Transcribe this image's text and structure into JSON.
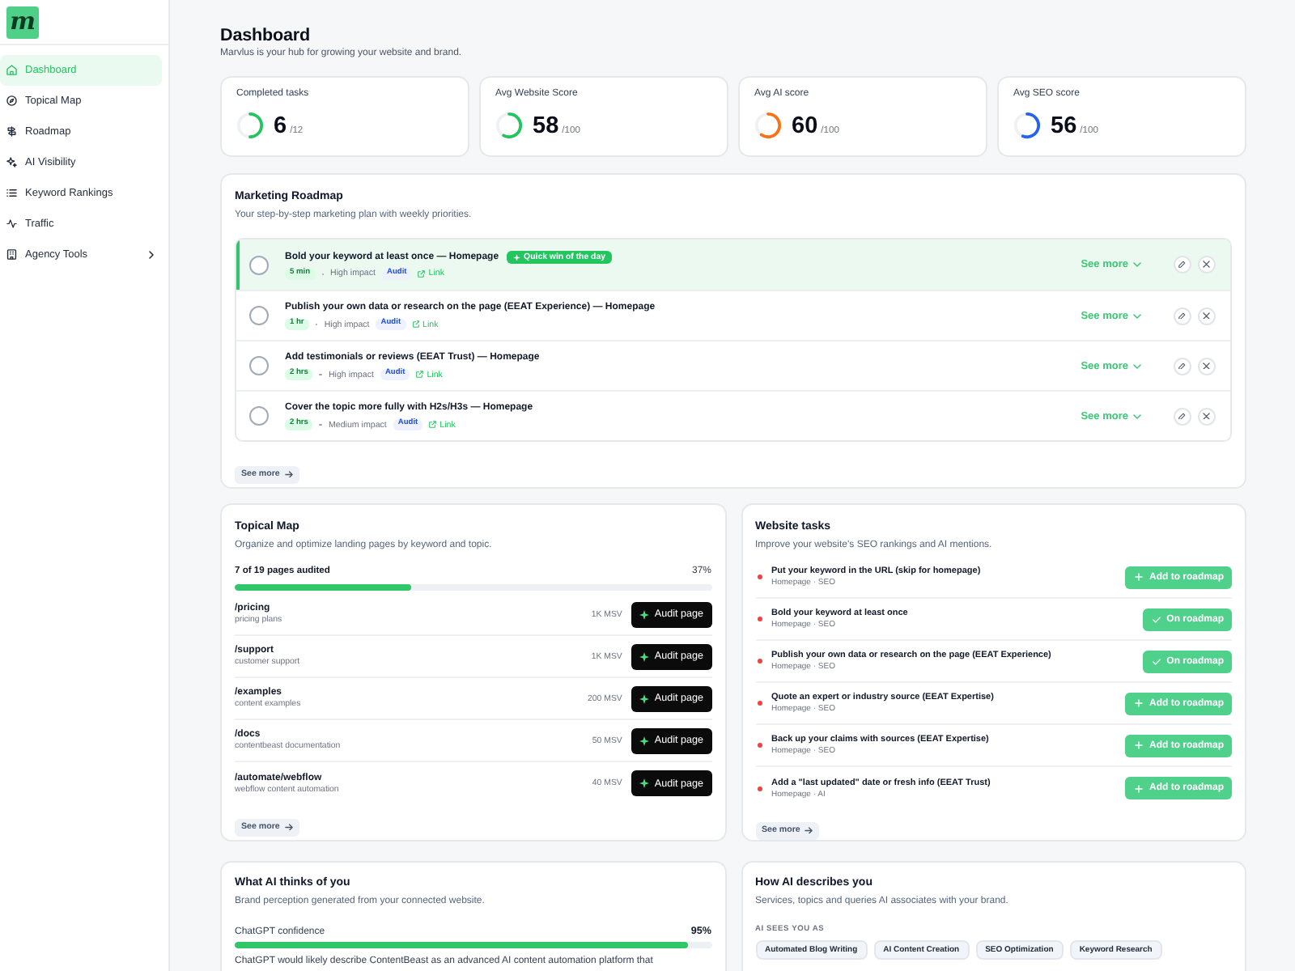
{
  "sidebar": {
    "logo": "m",
    "items": [
      {
        "label": "Dashboard",
        "selected": true,
        "expandable": false
      },
      {
        "label": "Topical Map",
        "selected": false,
        "expandable": false
      },
      {
        "label": "Roadmap",
        "selected": false,
        "expandable": false
      },
      {
        "label": "AI Visibility",
        "selected": false,
        "expandable": false
      },
      {
        "label": "Keyword Rankings",
        "selected": false,
        "expandable": false
      },
      {
        "label": "Traffic",
        "selected": false,
        "expandable": false
      },
      {
        "label": "Agency Tools",
        "selected": false,
        "expandable": true
      }
    ]
  },
  "header": {
    "title": "Dashboard",
    "subtitle": "Marvlus is your hub for growing your website and brand."
  },
  "stats": [
    {
      "label": "Completed tasks",
      "value": "6",
      "unit": "/12",
      "level": 0.5,
      "color": "#22c55e"
    },
    {
      "label": "Avg Website Score",
      "value": "58",
      "unit": "/100",
      "level": 0.58,
      "color": "#22c55e"
    },
    {
      "label": "Avg AI score",
      "value": "60",
      "unit": "/100",
      "level": 0.6,
      "color": "#f97316"
    },
    {
      "label": "Avg SEO score",
      "value": "56",
      "unit": "/100",
      "level": 0.56,
      "color": "#2563eb"
    }
  ],
  "roadmap": {
    "title": "Marketing Roadmap",
    "subtitle": "Your step-by-step marketing plan with weekly priorities.",
    "tasks": [
      {
        "title": "Bold your keyword at least once — Homepage",
        "badge": "Quick win of the day",
        "checked": false,
        "highlighted": true,
        "time": "5 min",
        "impact": "High impact",
        "tag": "Audit",
        "link": "Link",
        "action": "See more"
      },
      {
        "title": "Publish your own data or research on the page (EEAT Experience) — Homepage",
        "checked": false,
        "highlighted": false,
        "time": "1 hr",
        "impact": "High impact",
        "tag": "Audit",
        "link": "Link",
        "action": "See more"
      },
      {
        "title": "Add testimonials or reviews (EEAT Trust) — Homepage",
        "checked": false,
        "highlighted": false,
        "time": "2 hrs",
        "impact": "High impact",
        "tag": "Audit",
        "link": "Link",
        "action": "See more"
      },
      {
        "title": "Cover the topic more fully with H2s/H3s — Homepage",
        "checked": false,
        "highlighted": false,
        "time": "2 hrs",
        "impact": "Medium impact",
        "tag": "Audit",
        "link": "Link",
        "action": "See more"
      }
    ],
    "see_more": "See more"
  },
  "topical_map": {
    "title": "Topical Map",
    "subtitle": "Organize and optimize landing pages by keyword and topic.",
    "progress_label": "7 of 19 pages audited",
    "progress_value": "37%",
    "level": 0.37,
    "pages": [
      {
        "path": "/pricing",
        "description": "pricing plans",
        "volume": "1K MSV",
        "action": "Audit page"
      },
      {
        "path": "/support",
        "description": "customer support",
        "volume": "1K MSV",
        "action": "Audit page"
      },
      {
        "path": "/examples",
        "description": "content examples",
        "volume": "200 MSV",
        "action": "Audit page"
      },
      {
        "path": "/docs",
        "description": "contentbeast documentation",
        "volume": "50 MSV",
        "action": "Audit page"
      },
      {
        "path": "/automate/webflow",
        "description": "webflow content automation",
        "volume": "40 MSV",
        "action": "Audit page"
      }
    ],
    "see_more": "See more"
  },
  "website_tasks": {
    "title": "Website tasks",
    "subtitle": "Improve your website's SEO rankings and AI mentions.",
    "tasks": [
      {
        "title": "Put your keyword in the URL (skip for homepage)",
        "meta": "Homepage · SEO",
        "on_roadmap": false,
        "action": "Add to roadmap"
      },
      {
        "title": "Bold your keyword at least once",
        "meta": "Homepage · SEO",
        "on_roadmap": true,
        "action": "On roadmap"
      },
      {
        "title": "Publish your own data or research on the page (EEAT Experience)",
        "meta": "Homepage · SEO",
        "on_roadmap": true,
        "action": "On roadmap"
      },
      {
        "title": "Quote an expert or industry source (EEAT Expertise)",
        "meta": "Homepage · SEO",
        "on_roadmap": false,
        "action": "Add to roadmap"
      },
      {
        "title": "Back up your claims with sources (EEAT Expertise)",
        "meta": "Homepage · SEO",
        "on_roadmap": false,
        "action": "Add to roadmap"
      },
      {
        "title": "Add a \"last updated\" date or fresh info (EEAT Trust)",
        "meta": "Homepage · AI",
        "on_roadmap": false,
        "action": "Add to roadmap"
      }
    ],
    "see_more": "See more"
  },
  "ai_opinion": {
    "title": "What AI thinks of you",
    "subtitle": "Brand perception generated from your connected website.",
    "metric_label": "ChatGPT confidence",
    "metric_value": "95%",
    "level": 0.95,
    "summary": "ChatGPT would likely describe ContentBeast as an advanced AI content automation platform that"
  },
  "ai_description": {
    "title": "How AI describes you",
    "subtitle": "Services, topics and queries AI associates with your brand.",
    "section_label": "AI SEES YOU AS",
    "chips": [
      "Automated Blog Writing",
      "AI Content Creation",
      "SEO Optimization",
      "Keyword Research"
    ]
  }
}
